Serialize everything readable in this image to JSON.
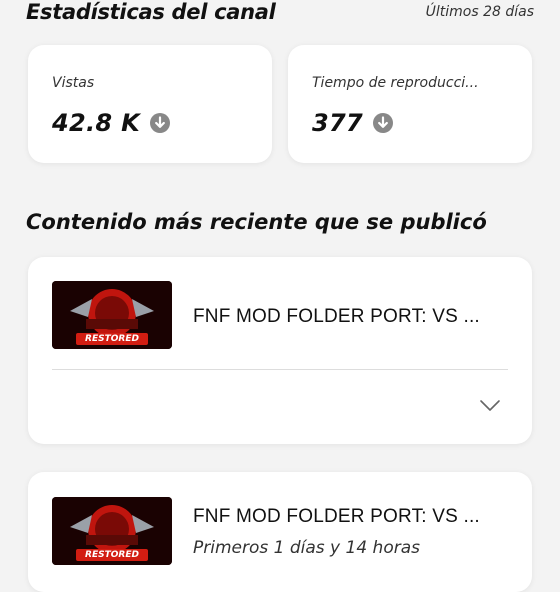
{
  "stats": {
    "title": "Estadísticas del canal",
    "period": "Últimos 28 días",
    "cards": [
      {
        "label": "Vistas",
        "value": "42.8 K",
        "trend_icon": "arrow-down-circle-icon"
      },
      {
        "label": "Tiempo de reproducci...",
        "value": "377",
        "trend_icon": "arrow-down-circle-icon"
      }
    ]
  },
  "recent": {
    "title": "Contenido más reciente que se publicó",
    "videos": [
      {
        "title": "FNF MOD FOLDER PORT: VS ...",
        "thumbnail_text": "RESTORED",
        "expand_icon": "chevron-down-icon"
      },
      {
        "title": "FNF MOD FOLDER PORT: VS ...",
        "subtitle": "Primeros 1 días y 14 horas",
        "thumbnail_text": "RESTORED"
      }
    ]
  },
  "colors": {
    "background": "#f3f3f3",
    "card": "#ffffff",
    "icon_gray": "#888888",
    "thumbnail_red": "#c0150e"
  }
}
